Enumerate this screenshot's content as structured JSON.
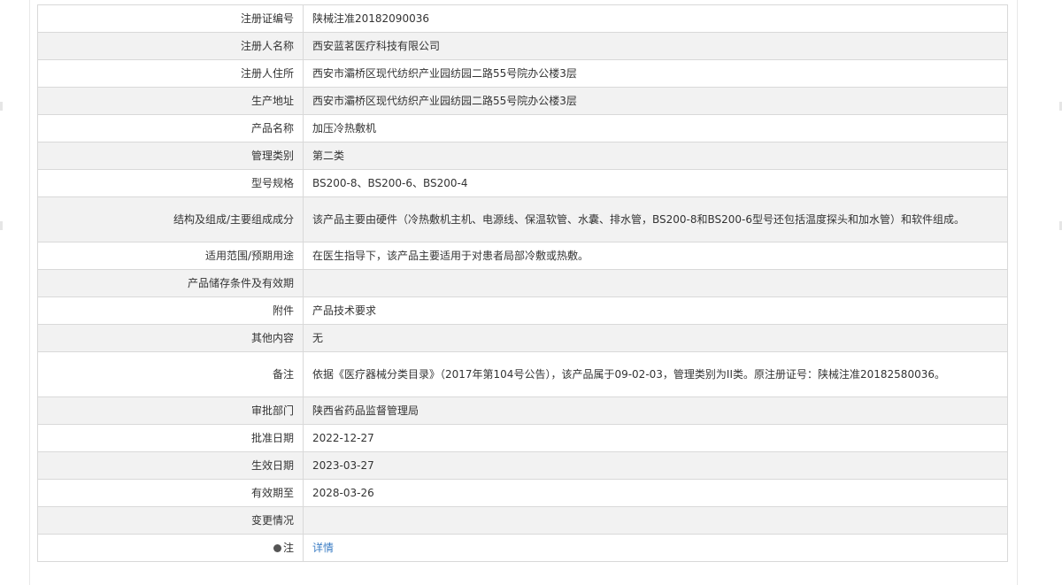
{
  "rows": [
    {
      "label": "注册证编号",
      "value": "陕械注准20182090036"
    },
    {
      "label": "注册人名称",
      "value": "西安蓝茗医疗科技有限公司"
    },
    {
      "label": "注册人住所",
      "value": "西安市灞桥区现代纺织产业园纺园二路55号院办公楼3层"
    },
    {
      "label": "生产地址",
      "value": "西安市灞桥区现代纺织产业园纺园二路55号院办公楼3层"
    },
    {
      "label": "产品名称",
      "value": "加压冷热敷机"
    },
    {
      "label": "管理类别",
      "value": "第二类"
    },
    {
      "label": "型号规格",
      "value": "BS200-8、BS200-6、BS200-4"
    },
    {
      "label": "结构及组成/主要组成成分",
      "value": "该产品主要由硬件（冷热敷机主机、电源线、保温软管、水囊、排水管，BS200-8和BS200-6型号还包括温度探头和加水管）和软件组成。"
    },
    {
      "label": "适用范围/预期用途",
      "value": "在医生指导下，该产品主要适用于对患者局部冷敷或热敷。"
    },
    {
      "label": "产品储存条件及有效期",
      "value": ""
    },
    {
      "label": "附件",
      "value": "产品技术要求"
    },
    {
      "label": "其他内容",
      "value": "无"
    },
    {
      "label": "备注",
      "value": "依据《医疗器械分类目录》（2017年第104号公告），该产品属于09-02-03，管理类别为II类。原注册证号：陕械注准20182580036。"
    },
    {
      "label": "审批部门",
      "value": "陕西省药品监督管理局"
    },
    {
      "label": "批准日期",
      "value": "2022-12-27"
    },
    {
      "label": "生效日期",
      "value": "2023-03-27"
    },
    {
      "label": "有效期至",
      "value": "2028-03-26"
    },
    {
      "label": "变更情况",
      "value": ""
    }
  ],
  "note": {
    "label": "注",
    "icon": "pin-icon",
    "link_text": "详情",
    "link_color": "#3b7dc4"
  }
}
